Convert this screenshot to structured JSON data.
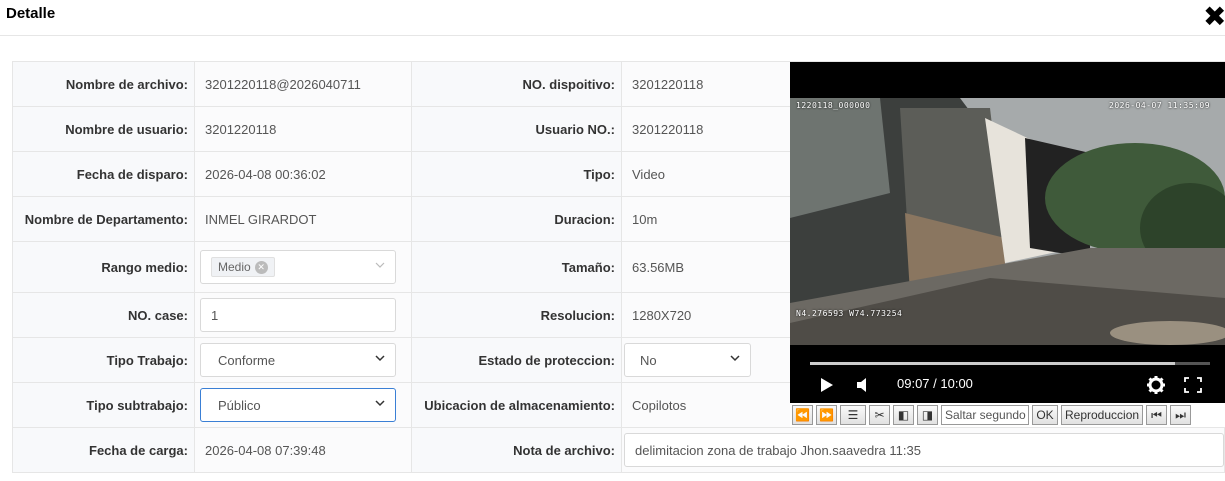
{
  "dialog": {
    "title": "Detalle"
  },
  "rows": [
    {
      "label1": "Nombre de archivo:",
      "value1": "3201220118@2026040711",
      "label2": "NO. dispoitivo:",
      "value2": "3201220118"
    },
    {
      "label1": "Nombre de usuario:",
      "value1": "3201220118",
      "label2": "Usuario NO.:",
      "value2": "3201220118"
    },
    {
      "label1": "Fecha de disparo:",
      "value1": "2026-04-08 00:36:02",
      "label2": "Tipo:",
      "value2": "Video"
    },
    {
      "label1": "Nombre de Departamento:",
      "value1": "INMEL GIRARDOT",
      "label2": "Duracion:",
      "value2": "10m"
    },
    {
      "label1": "Rango medio:",
      "value1_tag": "Medio",
      "label2": "Tamaño:",
      "value2": "63.56MB"
    },
    {
      "label1": "NO. case:",
      "value1_input": "1",
      "label2": "Resolucion:",
      "value2": "1280X720"
    },
    {
      "label1": "Tipo Trabajo:",
      "value1_select": "Conforme",
      "label2": "Estado de proteccion:",
      "value2_select": "No"
    },
    {
      "label1": "Tipo subtrabajo:",
      "value1_select": "Público",
      "label2": "Ubicacion de almacenamiento:",
      "value2": "Copilotos"
    },
    {
      "label1": "Fecha de carga:",
      "value1": "2026-04-08 07:39:48",
      "label2": "Nota de archivo:",
      "value2_input": "delimitacion zona de trabajo Jhon.saavedra 11:35"
    }
  ],
  "player": {
    "osd_device": "1220118_000000",
    "osd_datetime": "2026-04-07 11:35:09",
    "osd_gps": "N4.276593  W74.773254",
    "time": "09:07 / 10:00",
    "progress": 0.9117
  },
  "toolbar": {
    "skip_placeholder": "Saltar segundo",
    "ok_label": "OK",
    "playback_label": "Reproduccion"
  }
}
